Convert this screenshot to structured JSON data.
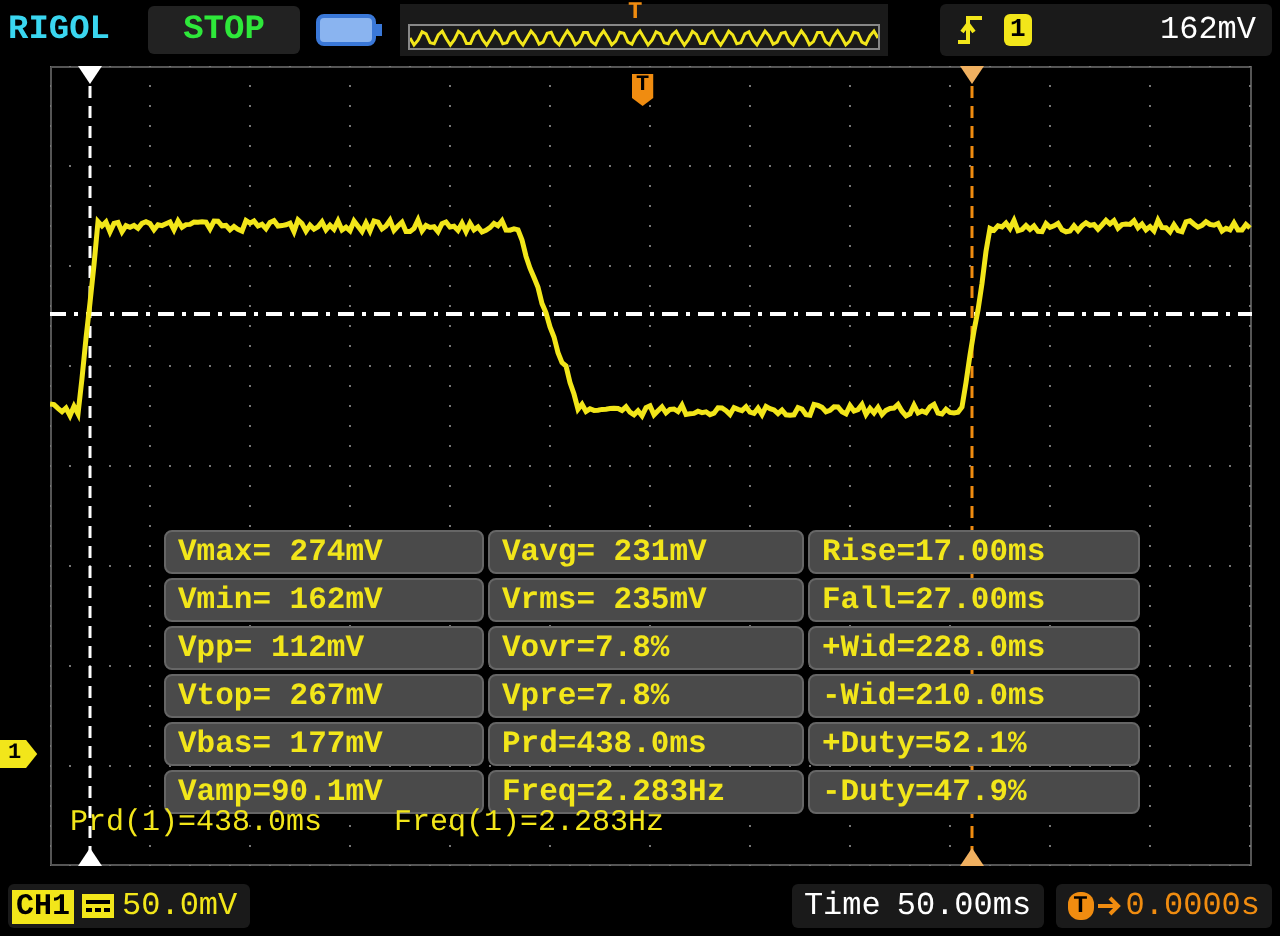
{
  "header": {
    "brand": "RIGOL",
    "run_state": "STOP",
    "memory_marker": "T",
    "trigger": {
      "channel": "1",
      "level": "162mV"
    }
  },
  "trigger_marker": "T",
  "channel_marker": "1",
  "measurements": [
    [
      "Vmax= 274mV",
      "Vavg= 231mV",
      "Rise=17.00ms"
    ],
    [
      "Vmin= 162mV",
      "Vrms= 235mV",
      "Fall=27.00ms"
    ],
    [
      "Vpp= 112mV",
      "Vovr=7.8%",
      "+Wid=228.0ms"
    ],
    [
      "Vtop= 267mV",
      "Vpre=7.8%",
      "-Wid=210.0ms"
    ],
    [
      "Vbas= 177mV",
      "Prd=438.0ms",
      "+Duty=52.1%"
    ],
    [
      "Vamp=90.1mV",
      "Freq=2.283Hz",
      "-Duty=47.9%"
    ]
  ],
  "cursor_readouts": [
    "Prd(1)=438.0ms",
    "Freq(1)=2.283Hz"
  ],
  "footer": {
    "channel": "CH1",
    "scale": "50.0mV",
    "time_label": "Time",
    "timebase": "50.00ms",
    "offset_badge": "T",
    "offset": "0.0000s"
  }
}
